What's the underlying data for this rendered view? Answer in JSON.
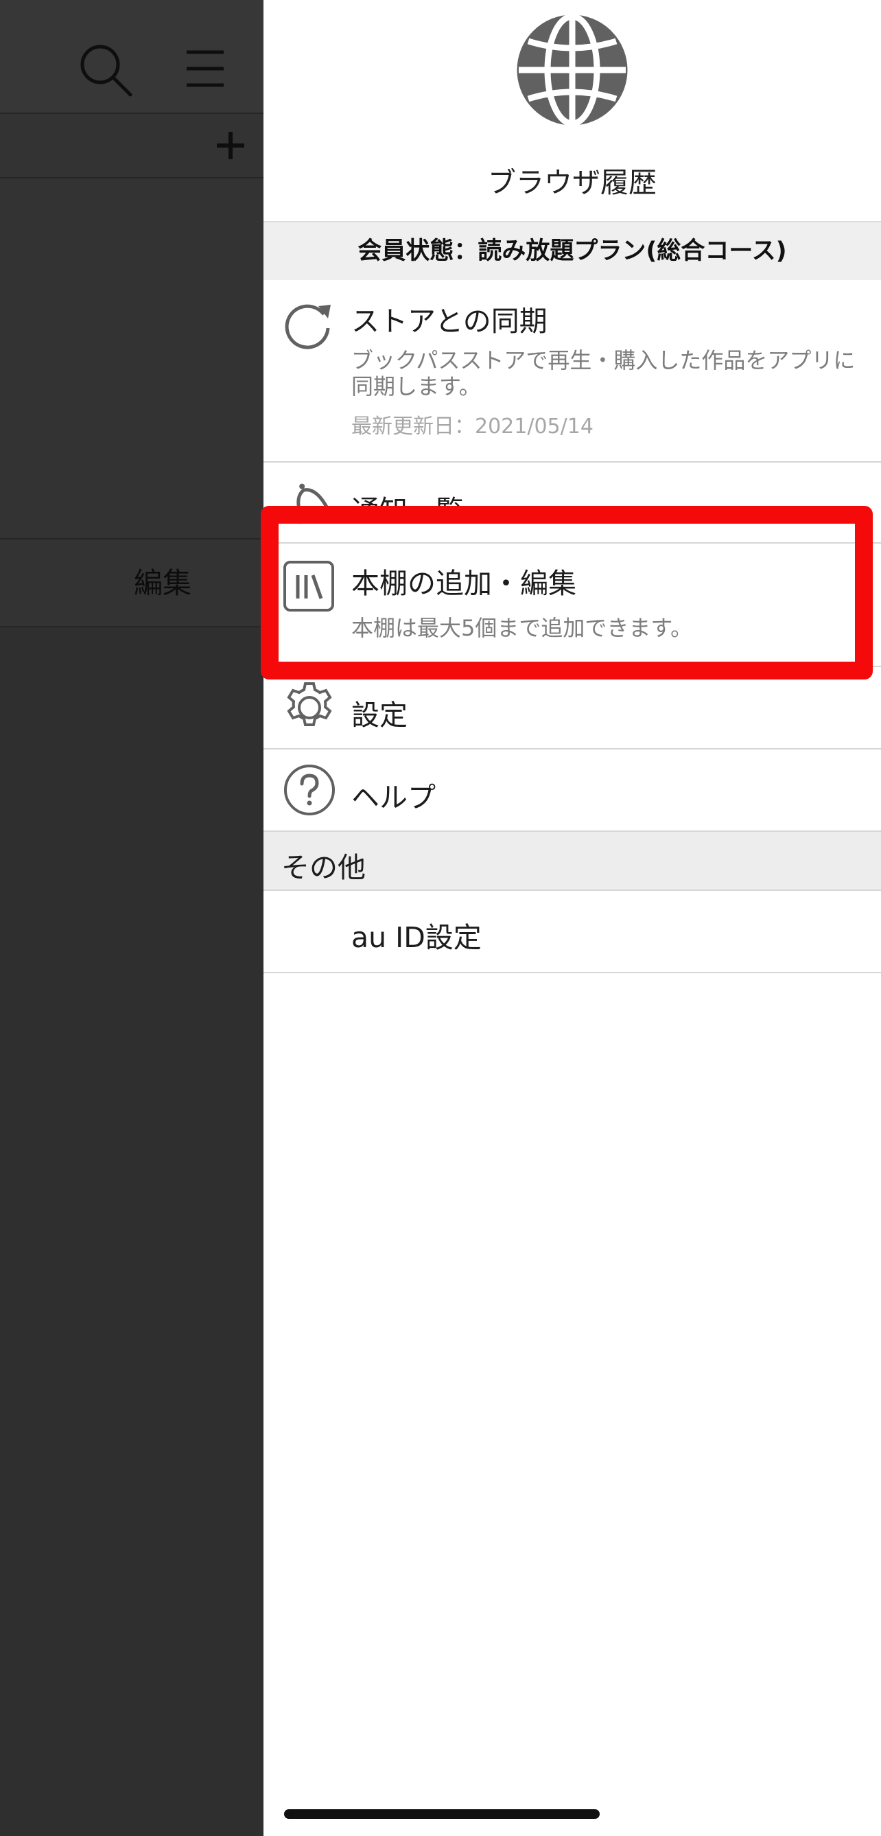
{
  "background": {
    "edit_label": "編集"
  },
  "drawer": {
    "header_title": "ブラウザ履歴",
    "member_status": "会員状態：読み放題プラン(総合コース)",
    "sync": {
      "title": "ストアとの同期",
      "description": "ブックパスストアで再生・購入した作品をアプリに同期します。",
      "last_updated": "最新更新日：2021/05/14"
    },
    "notifications": {
      "title": "通知一覧"
    },
    "bookshelf": {
      "title": "本棚の追加・編集",
      "description": "本棚は最大5個まで追加できます。"
    },
    "settings": {
      "title": "設定"
    },
    "help": {
      "title": "ヘルプ"
    },
    "other_section": {
      "title": "その他",
      "items": [
        {
          "label": "au ID設定"
        }
      ]
    }
  },
  "colors": {
    "highlight": "#f40a0a",
    "icon": "#616161",
    "dim_background": "#2f2f2f"
  },
  "icons": {
    "globe": "globe-icon",
    "sync": "refresh-icon",
    "notifications": "bell-icon",
    "bookshelf": "bookshelf-icon",
    "settings": "gear-icon",
    "help": "question-icon",
    "search": "search-icon",
    "menu": "hamburger-icon",
    "add": "plus-icon"
  }
}
